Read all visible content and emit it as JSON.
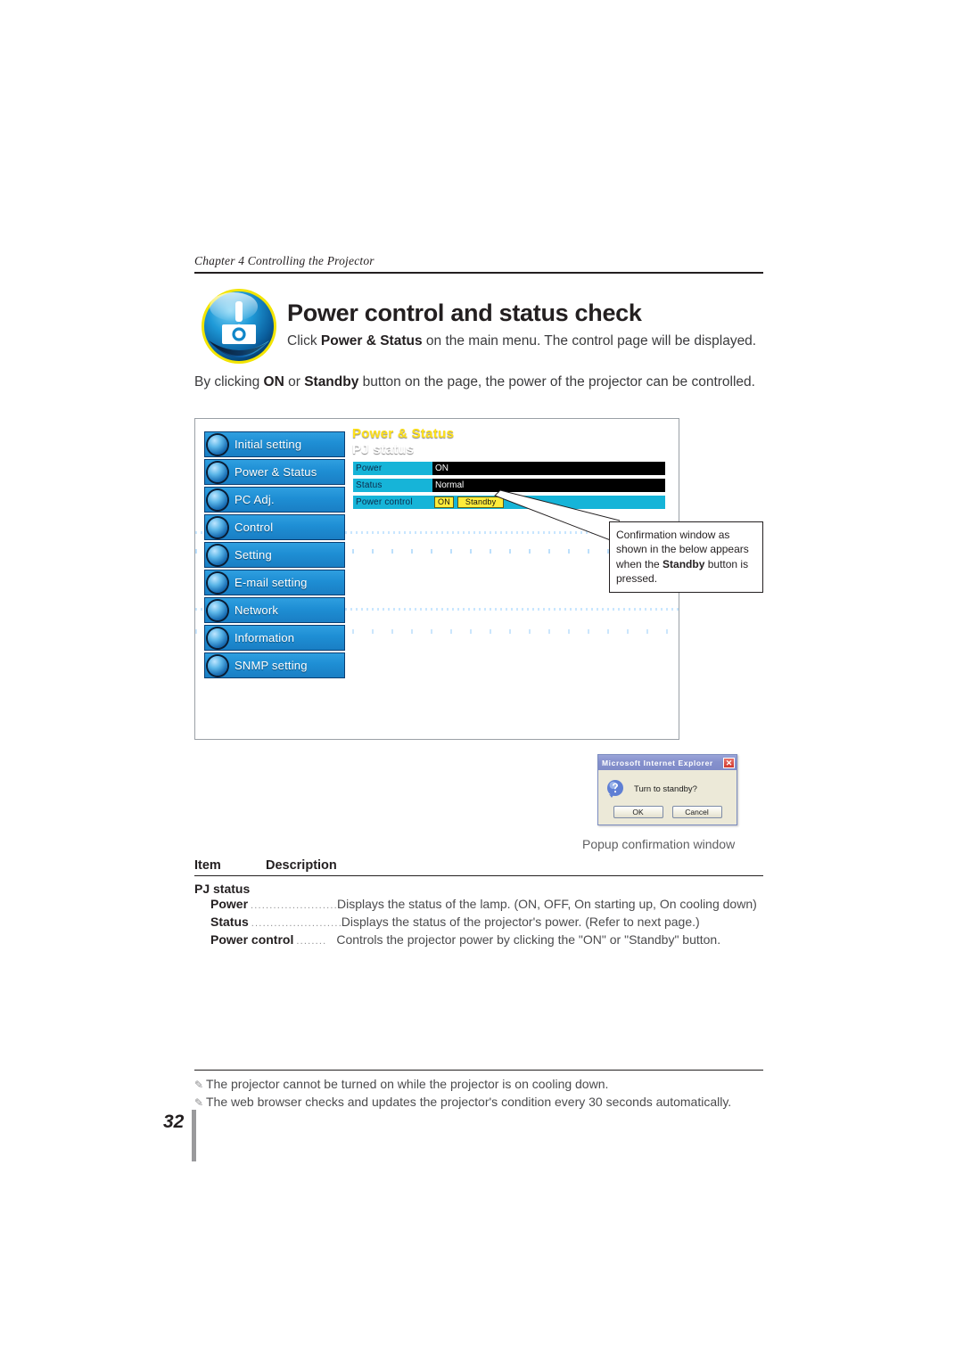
{
  "running_head": "Chapter 4 Controlling the Projector",
  "title": "Power control and status check",
  "intro": {
    "line1_a": "Click ",
    "line1_b": "Power & Status",
    "line1_c": " on the main menu. The control page will be displayed.",
    "line2_a": "By clicking ",
    "line2_b": "ON",
    "line2_c": " or ",
    "line2_d": "Standby",
    "line2_e": " button on the page, the power of the projector can be controlled."
  },
  "screenshot": {
    "nav": [
      {
        "label": "Initial setting",
        "icon": "gear-globe-icon"
      },
      {
        "label": "Power & Status",
        "icon": "power-status-icon"
      },
      {
        "label": "PC Adj.",
        "icon": "monitor-icon"
      },
      {
        "label": "Control",
        "icon": "control-icon"
      },
      {
        "label": "Setting",
        "icon": "wrench-icon"
      },
      {
        "label": "E-mail setting",
        "icon": "envelope-icon"
      },
      {
        "label": "Network",
        "icon": "network-icon"
      },
      {
        "label": "Information",
        "icon": "info-icon"
      },
      {
        "label": "SNMP setting",
        "icon": "snmp-icon"
      }
    ],
    "content_title": "Power & Status",
    "content_subtitle": "PJ status",
    "rows": [
      {
        "key": "Power",
        "value": "ON"
      },
      {
        "key": "Status",
        "value": "Normal"
      }
    ],
    "control_row": {
      "key": "Power control",
      "btn_on": "ON",
      "btn_standby": "Standby"
    }
  },
  "callout": {
    "part1": "Confirmation window as shown in the below appears  when the ",
    "bold": "Standby",
    "part2": " button is pressed."
  },
  "dialog": {
    "title": "Microsoft Internet Explorer",
    "close": "✕",
    "message": "Turn to standby?",
    "ok": "OK",
    "cancel": "Cancel"
  },
  "caption_popup": "Popup confirmation window",
  "table": {
    "header_item": "Item",
    "header_description": "Description",
    "group": "PJ status",
    "rows": [
      {
        "item": "Power",
        "dots": "........................",
        "desc": "Displays the status of the lamp. (ON, OFF, On starting up, On cooling down)"
      },
      {
        "item": "Status",
        "dots": "........................",
        "desc": "Displays the status of the projector's power. (Refer to next page.)"
      },
      {
        "item": "Power control",
        "dots": "........",
        "desc": "Controls the projector power by clicking the \"ON\" or \"Standby\" button."
      }
    ]
  },
  "notes": [
    "The projector cannot be turned on while the projector is on cooling down.",
    "The web browser checks and updates the projector's condition every 30 seconds automatically."
  ],
  "page_number": "32"
}
